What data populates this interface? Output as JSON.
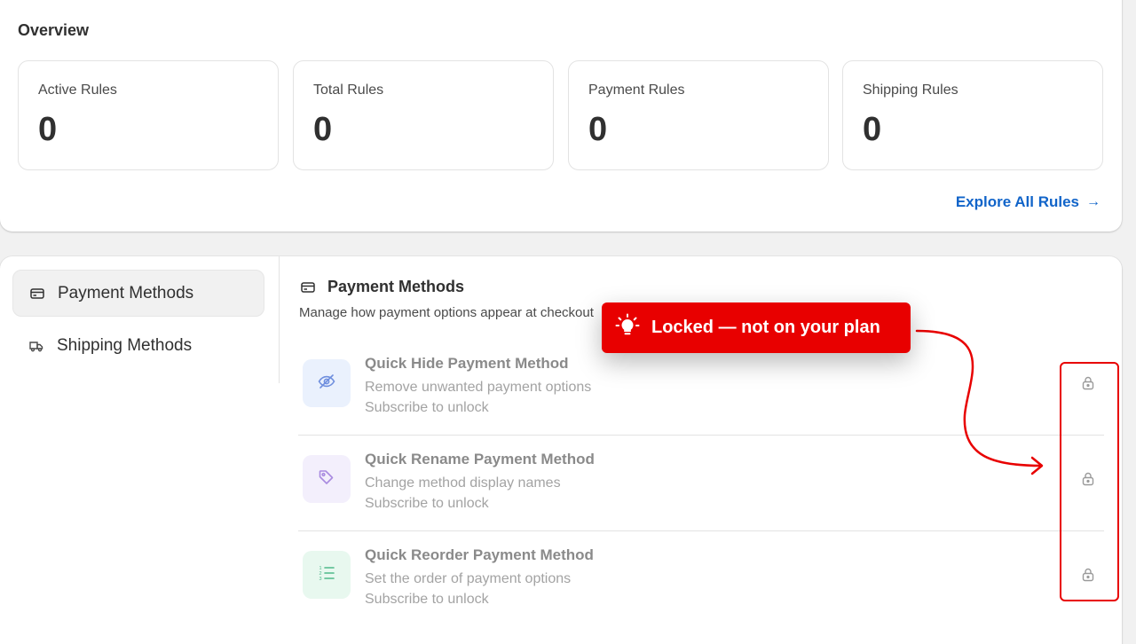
{
  "overview": {
    "title": "Overview",
    "stats": [
      {
        "label": "Active Rules",
        "value": "0"
      },
      {
        "label": "Total Rules",
        "value": "0"
      },
      {
        "label": "Payment Rules",
        "value": "0"
      },
      {
        "label": "Shipping Rules",
        "value": "0"
      }
    ],
    "explore_label": "Explore All Rules",
    "explore_arrow": "→"
  },
  "nav": {
    "items": [
      {
        "label": "Payment Methods",
        "icon": "credit-card-icon",
        "active": true
      },
      {
        "label": "Shipping Methods",
        "icon": "truck-icon",
        "active": false
      }
    ]
  },
  "section": {
    "title": "Payment Methods",
    "subtitle": "Manage how payment options appear at checkout"
  },
  "methods": [
    {
      "title": "Quick Hide Payment Method",
      "description": "Remove unwanted payment options",
      "status": "Subscribe to unlock",
      "icon": "eye-off-icon",
      "icon_color": "#6f8fde",
      "icon_bg": "#eaf1fd"
    },
    {
      "title": "Quick Rename Payment Method",
      "description": "Change method display names",
      "status": "Subscribe to unlock",
      "icon": "tag-icon",
      "icon_color": "#a98be0",
      "icon_bg": "#f3effc"
    },
    {
      "title": "Quick Reorder Payment Method",
      "description": "Set the order of payment options",
      "status": "Subscribe to unlock",
      "icon": "ordered-list-icon",
      "icon_color": "#4fb98a",
      "icon_bg": "#e8f8ef"
    }
  ],
  "annotation": {
    "callout_text": "Locked — not on your plan",
    "color": "#e80000"
  }
}
